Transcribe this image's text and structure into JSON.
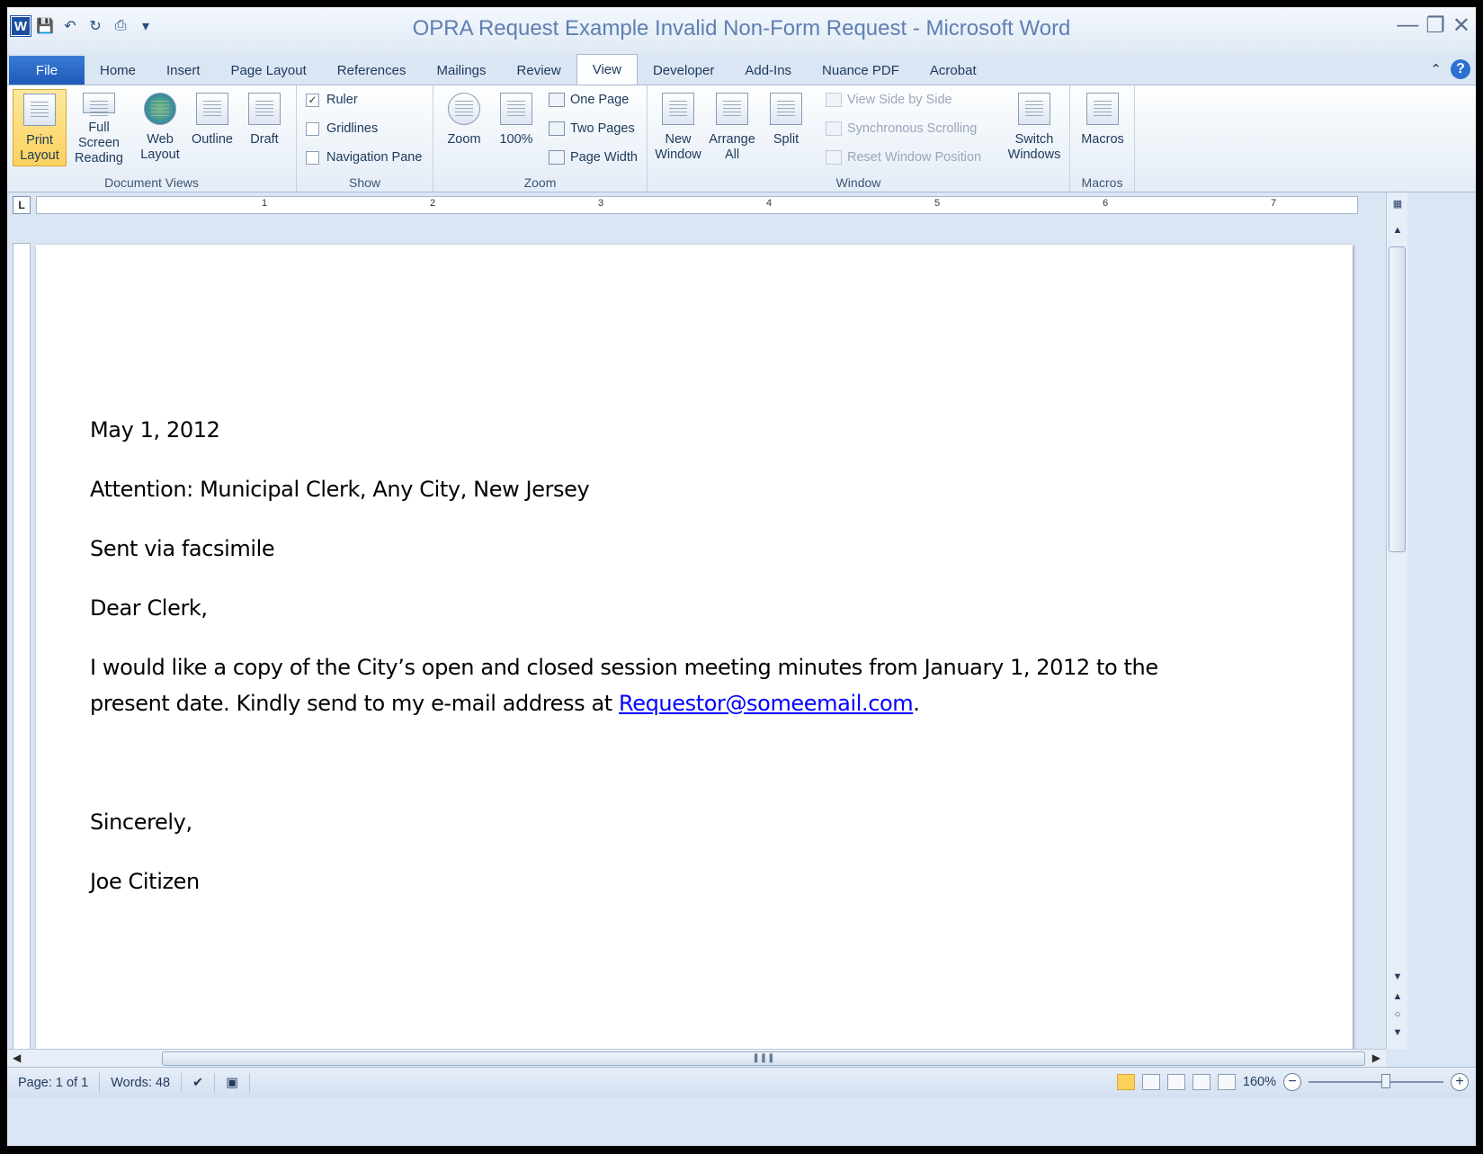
{
  "window": {
    "title": "OPRA Request Example Invalid Non-Form Request  -  Microsoft Word",
    "controls": [
      "minimize-icon",
      "restore-icon",
      "close-icon"
    ]
  },
  "qat": {
    "icons": [
      "word-logo-icon",
      "save-icon",
      "undo-icon",
      "redo-icon",
      "quick-print-icon",
      "customize-qat-icon"
    ],
    "logo_letter": "W"
  },
  "tabs": {
    "file": "File",
    "items": [
      "Home",
      "Insert",
      "Page Layout",
      "References",
      "Mailings",
      "Review",
      "View",
      "Developer",
      "Add-Ins",
      "Nuance PDF",
      "Acrobat"
    ],
    "active": "View",
    "help_glyph": "?"
  },
  "ribbon": {
    "document_views": {
      "label": "Document Views",
      "print_layout": "Print Layout",
      "full_screen_reading": "Full Screen Reading",
      "web_layout": "Web Layout",
      "outline": "Outline",
      "draft": "Draft"
    },
    "show": {
      "label": "Show",
      "ruler": "Ruler",
      "ruler_checked": true,
      "gridlines": "Gridlines",
      "gridlines_checked": false,
      "navigation_pane": "Navigation Pane",
      "navigation_pane_checked": false
    },
    "zoom": {
      "label": "Zoom",
      "zoom": "Zoom",
      "hundred": "100%",
      "one_page": "One Page",
      "two_pages": "Two Pages",
      "page_width": "Page Width"
    },
    "window": {
      "label": "Window",
      "new_window": "New Window",
      "arrange_all": "Arrange All",
      "split": "Split",
      "view_side_by_side": "View Side by Side",
      "synchronous_scrolling": "Synchronous Scrolling",
      "reset_window_position": "Reset Window Position",
      "switch_windows": "Switch Windows"
    },
    "macros": {
      "label": "Macros",
      "macros": "Macros"
    }
  },
  "ruler": {
    "numbers": [
      "1",
      "2",
      "3",
      "4",
      "5",
      "6",
      "7"
    ],
    "corner_glyph": "L"
  },
  "document": {
    "date": "May 1, 2012",
    "attention": "Attention: Municipal Clerk, Any City, New Jersey",
    "sent_via": "Sent via facsimile",
    "salutation": "Dear Clerk,",
    "body_line1": "I would like a copy of the City’s open and closed session meeting minutes from January 1, 2012 to the",
    "body_line2_pre": "present date.  Kindly send to my e-mail address at ",
    "email": "Requestor@someemail.com",
    "body_line2_post": ".",
    "closing": "Sincerely,",
    "signature": "Joe Citizen"
  },
  "status": {
    "page": "Page: 1 of 1",
    "words": "Words: 48",
    "zoom": "160%",
    "zoom_percent": 160
  }
}
